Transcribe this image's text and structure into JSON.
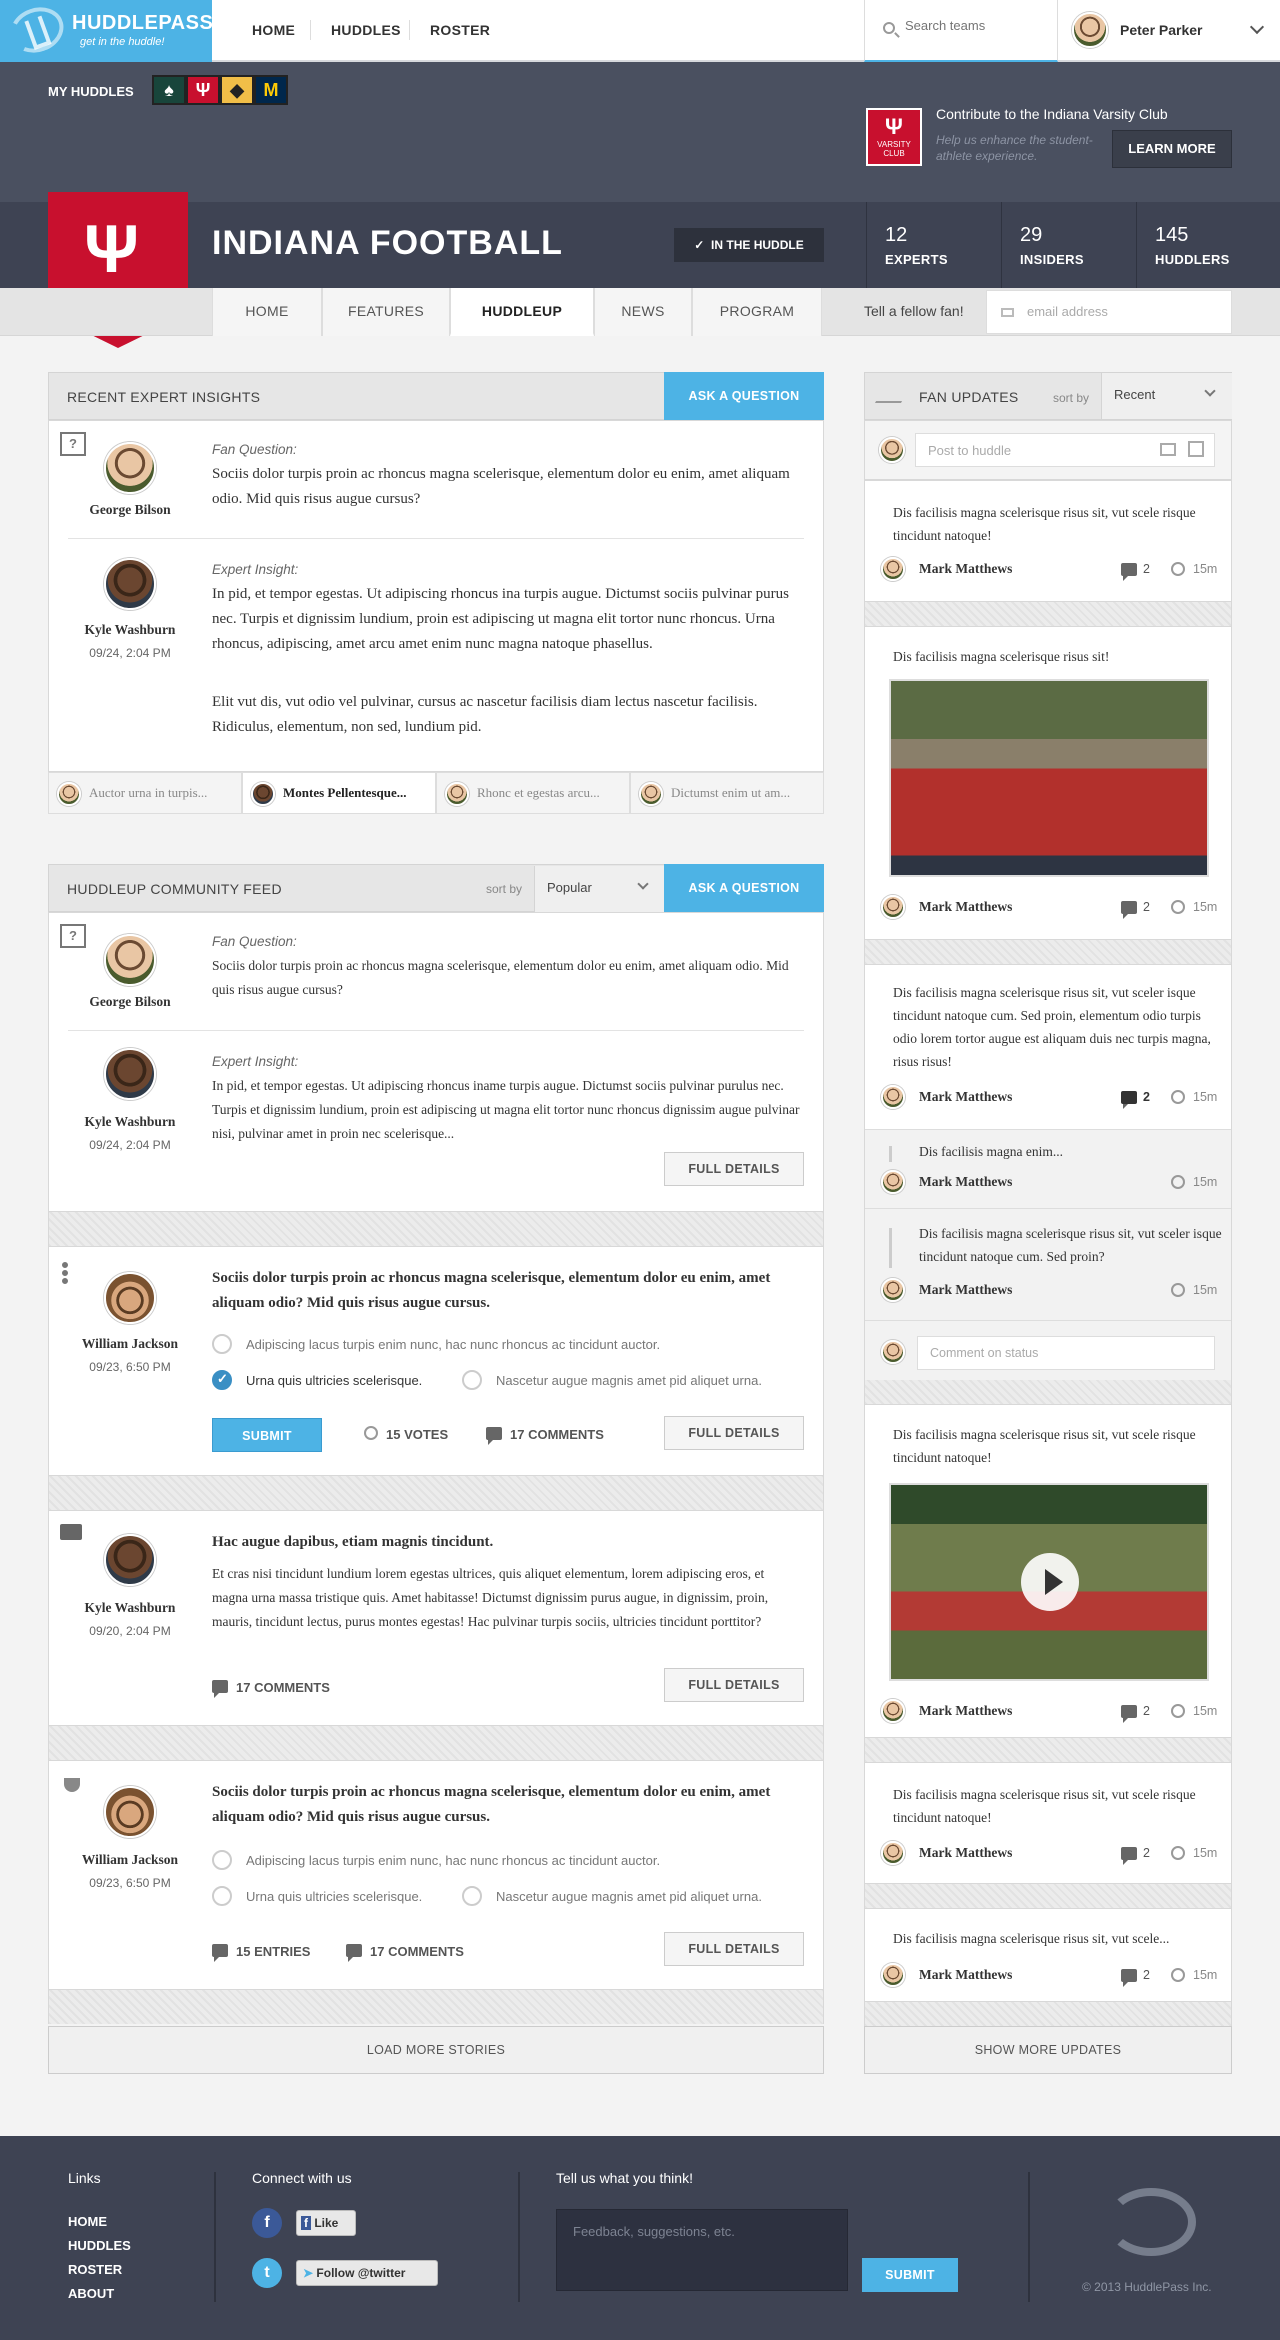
{
  "brand": {
    "name": "HUDDLEPASS",
    "tagline": "get in the huddle!"
  },
  "nav": {
    "items": [
      "HOME",
      "HUDDLES",
      "ROSTER"
    ]
  },
  "search": {
    "placeholder": "Search teams"
  },
  "user": {
    "name": "Peter Parker"
  },
  "my_huddles": {
    "label": "MY HUDDLES",
    "teams": [
      {
        "glyph": "♠",
        "bg": "#18453b",
        "fg": "#ffffff"
      },
      {
        "glyph": "Ψ",
        "bg": "#c8102e",
        "fg": "#ffffff"
      },
      {
        "glyph": "◆",
        "bg": "#f1be48",
        "fg": "#222222"
      },
      {
        "glyph": "M",
        "bg": "#00274c",
        "fg": "#ffcb05"
      }
    ]
  },
  "contribute": {
    "badge": "VARSITY CLUB",
    "title": "Contribute to the Indiana Varsity Club",
    "subtitle": "Help us enhance the student-athlete experience.",
    "button": "LEARN MORE"
  },
  "team": {
    "name": "INDIANA FOOTBALL",
    "in_huddle": "IN THE HUDDLE"
  },
  "stats": [
    {
      "num": "12",
      "label": "EXPERTS"
    },
    {
      "num": "29",
      "label": "INSIDERS"
    },
    {
      "num": "145",
      "label": "HUDDLERS"
    }
  ],
  "tabs": [
    "HOME",
    "FEATURES",
    "HUDDLEUP",
    "NEWS",
    "PROGRAM"
  ],
  "tell_fan": {
    "label": "Tell a fellow fan!",
    "placeholder": "email address"
  },
  "insights": {
    "title": "RECENT EXPERT INSIGHTS",
    "ask": "ASK A QUESTION",
    "q_label": "Fan Question:",
    "q_name": "George Bilson",
    "q_text": "Sociis dolor turpis proin ac rhoncus magna scelerisque, elementum dolor eu enim, amet aliquam odio. Mid quis risus augue cursus?",
    "a_label": "Expert Insight:",
    "a_name": "Kyle Washburn",
    "a_date": "09/24, 2:04 PM",
    "a_text1": "In pid, et tempor egestas. Ut adipiscing rhoncus ina turpis augue. Dictumst sociis pulvinar purus nec. Turpis et dignissim lundium, proin est adipiscing ut magna elit tortor nunc rhoncus. Urna rhoncus, adipiscing, amet arcu amet enim nunc magna natoque phasellus.",
    "a_text2": "Elit vut dis, vut odio vel pulvinar, cursus ac nascetur facilisis diam lectus nascetur facilisis. Ridiculus, elementum, non sed, lundium pid.",
    "thumbs": [
      "Auctor urna in turpis...",
      "Montes Pellentesque...",
      "Rhonc et egestas arcu...",
      "Dictumst enim ut am..."
    ]
  },
  "feed": {
    "title": "HUDDLEUP COMMUNITY FEED",
    "sort_label": "sort by",
    "sort_value": "Popular",
    "ask": "ASK A QUESTION",
    "item1": {
      "q_label": "Fan Question:",
      "q_name": "George Bilson",
      "q_text": "Sociis dolor turpis proin ac rhoncus magna scelerisque, elementum dolor eu enim, amet aliquam odio. Mid quis risus augue cursus?",
      "a_label": "Expert Insight:",
      "a_name": "Kyle Washburn",
      "a_date": "09/24, 2:04 PM",
      "a_text": "In pid, et tempor egestas. Ut adipiscing rhoncus iname turpis augue. Dictumst sociis pulvinar purulus nec. Turpis et dignissim lundium, proin est adipiscing ut magna elit tortor nunc rhoncus dignissim augue pulvinar nisi, pulvinar amet in proin nec scelerisque...",
      "btn": "FULL DETAILS"
    },
    "item2": {
      "name": "William Jackson",
      "date": "09/23, 6:50 PM",
      "title": "Sociis dolor turpis proin ac rhoncus magna scelerisque, elementum dolor eu enim, amet aliquam odio? Mid quis risus augue cursus.",
      "opt1": "Adipiscing lacus turpis enim nunc, hac nunc rhoncus ac tincidunt auctor.",
      "opt2": "Urna quis ultricies scelerisque.",
      "opt3": "Nascetur augue magnis amet pid aliquet urna.",
      "submit": "SUBMIT",
      "votes": "15 VOTES",
      "comments": "17 COMMENTS",
      "btn": "FULL DETAILS"
    },
    "item3": {
      "name": "Kyle Washburn",
      "date": "09/20, 2:04 PM",
      "title": "Hac augue dapibus, etiam magnis tincidunt.",
      "text": "Et cras nisi tincidunt lundium lorem egestas ultrices, quis aliquet elementum, lorem adipiscing eros, et magna urna massa tristique quis. Amet habitasse! Dictumst dignissim purus augue, in dignissim, proin, mauris, tincidunt lectus, purus montes egestas! Hac pulvinar turpis sociis, ultricies tincidunt porttitor?",
      "comments": "17 COMMENTS",
      "btn": "FULL DETAILS"
    },
    "item4": {
      "name": "William Jackson",
      "date": "09/23, 6:50 PM",
      "title": "Sociis dolor turpis proin ac rhoncus magna scelerisque, elementum dolor eu enim, amet aliquam odio? Mid quis risus augue cursus.",
      "opt1": "Adipiscing lacus turpis enim nunc, hac nunc rhoncus ac tincidunt auctor.",
      "opt2": "Urna quis ultricies scelerisque.",
      "opt3": "Nascetur augue magnis amet pid aliquet urna.",
      "entries": "15 ENTRIES",
      "comments": "17 COMMENTS",
      "btn": "FULL DETAILS"
    },
    "load_more": "LOAD MORE STORIES"
  },
  "fan_updates": {
    "title": "FAN UPDATES",
    "sort_label": "sort by",
    "sort_value": "Recent",
    "post_placeholder": "Post to huddle",
    "cards": [
      {
        "text": "Dis facilisis magna scelerisque risus sit, vut scele risque tincidunt natoque!",
        "name": "Mark Matthews",
        "count": "2",
        "time": "15m"
      },
      {
        "text": "Dis facilisis magna scelerisque risus sit!",
        "name": "Mark Matthews",
        "count": "2",
        "time": "15m"
      },
      {
        "text": "Dis facilisis magna scelerisque risus sit, vut sceler isque tincidunt natoque cum. Sed proin, elementum odio turpis odio lorem tortor augue est aliquam duis nec turpis magna, risus risus!",
        "name": "Mark Matthews",
        "count": "2",
        "time": "15m"
      },
      {
        "text": "Dis facilisis magna scelerisque risus sit, vut scele risque tincidunt natoque!",
        "name": "Mark Matthews",
        "count": "2",
        "time": "15m"
      },
      {
        "text": "Dis facilisis magna scelerisque risus sit, vut scele risque tincidunt natoque!",
        "name": "Mark Matthews",
        "count": "2",
        "time": "15m"
      },
      {
        "text": "Dis facilisis magna scelerisque risus sit, vut scele...",
        "name": "Mark Matthews",
        "count": "2",
        "time": "15m"
      }
    ],
    "replies": [
      {
        "text": "Dis facilisis magna enim...",
        "name": "Mark Matthews",
        "time": "15m"
      },
      {
        "text": "Dis facilisis magna scelerisque risus sit, vut sceler isque tincidunt natoque cum. Sed proin?",
        "name": "Mark Matthews",
        "time": "15m"
      }
    ],
    "comment_placeholder": "Comment on status",
    "show_more": "SHOW MORE UPDATES"
  },
  "footer": {
    "links_title": "Links",
    "links": [
      "HOME",
      "HUDDLES",
      "ROSTER",
      "ABOUT"
    ],
    "connect_title": "Connect with us",
    "fb_like": "Like",
    "twitter_follow": "Follow @twitter",
    "feedback_title": "Tell us what you think!",
    "feedback_placeholder": "Feedback, suggestions, etc.",
    "submit": "SUBMIT",
    "copyright": "© 2013 HuddlePass Inc."
  }
}
